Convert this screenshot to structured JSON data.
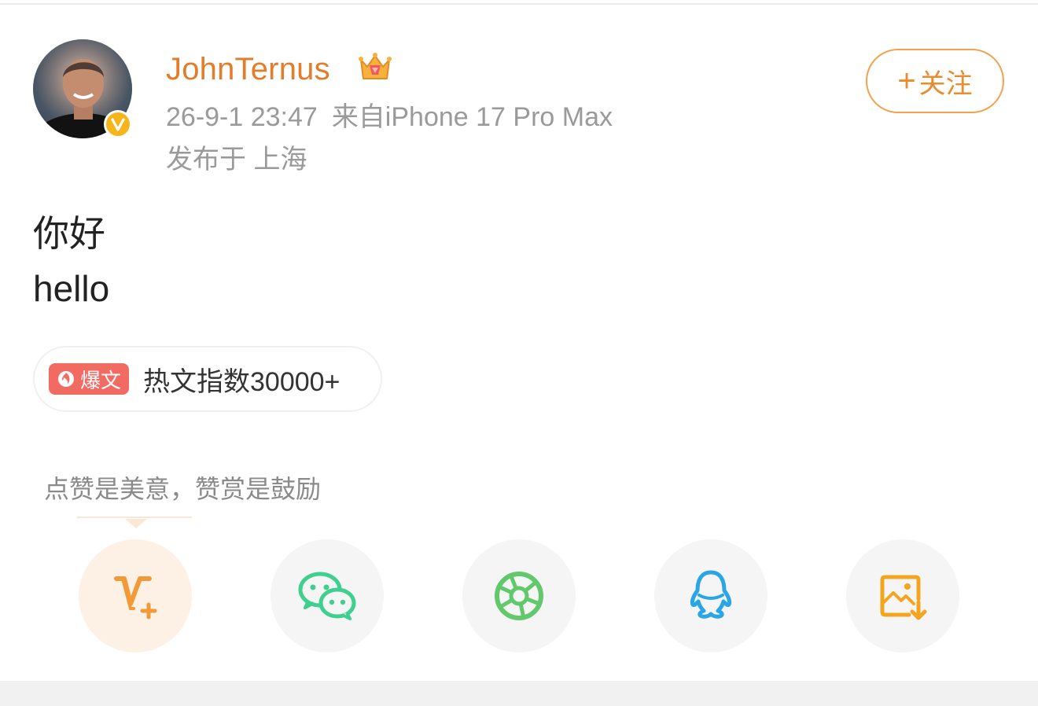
{
  "post": {
    "username": "JohnTernus",
    "timestamp": "26-9-1 23:47",
    "source": "来自iPhone 17 Pro Max",
    "location": "发布于 上海",
    "lines": [
      "你好",
      "hello"
    ],
    "verified_badge_text": "v"
  },
  "follow": {
    "plus": "+",
    "label": "关注"
  },
  "hot": {
    "badge_label": "爆文",
    "text": "热文指数30000+"
  },
  "reward_tip": {
    "text": "点赞是美意，赞赏是鼓励"
  },
  "share_actions": [
    {
      "name": "reward",
      "icon": "v-plus-icon"
    },
    {
      "name": "wechat",
      "icon": "wechat-icon"
    },
    {
      "name": "moments",
      "icon": "moments-aperture-icon"
    },
    {
      "name": "qq",
      "icon": "qq-icon"
    },
    {
      "name": "save-image",
      "icon": "save-image-icon"
    }
  ],
  "colors": {
    "accent_orange": "#e17d2b",
    "meta_gray": "#9a9a9a",
    "hot_badge": "#f26b63",
    "wechat_green": "#3fcf8e",
    "moments_green": "#61c96b",
    "qq_blue": "#2aa6e6",
    "save_orange": "#f3a51f"
  }
}
